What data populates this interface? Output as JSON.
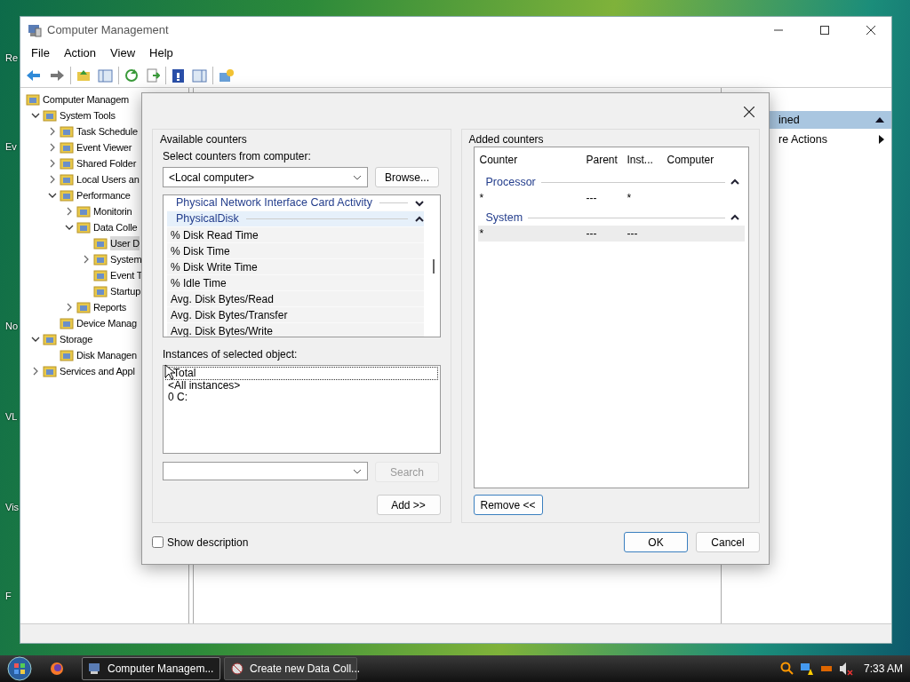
{
  "desktop": {
    "icon_labels": [
      {
        "label": "Re"
      },
      {
        "label": "Ev"
      },
      {
        "label": "No"
      },
      {
        "label": "VL"
      },
      {
        "label": "Vis"
      },
      {
        "label": "F"
      }
    ]
  },
  "window": {
    "title": "Computer Management"
  },
  "menu": [
    "File",
    "Action",
    "View",
    "Help"
  ],
  "tree": [
    {
      "label": "Computer Managem",
      "selected": false,
      "children": [
        {
          "label": "System Tools",
          "expanded": true,
          "selected": false,
          "children": [
            {
              "label": "Task Schedule",
              "expanded": false,
              "selected": false
            },
            {
              "label": "Event Viewer",
              "expanded": false,
              "selected": false
            },
            {
              "label": "Shared Folder",
              "expanded": false,
              "selected": false
            },
            {
              "label": "Local Users an",
              "expanded": false,
              "selected": false
            },
            {
              "label": "Performance",
              "expanded": true,
              "selected": false,
              "children": [
                {
                  "label": "Monitorin",
                  "expanded": false,
                  "selected": false
                },
                {
                  "label": "Data Colle",
                  "expanded": true,
                  "selected": false,
                  "children": [
                    {
                      "label": "User D",
                      "selected": true
                    },
                    {
                      "label": "System",
                      "expanded": false,
                      "selected": false
                    },
                    {
                      "label": "Event T",
                      "selected": false
                    },
                    {
                      "label": "Startup",
                      "selected": false
                    }
                  ]
                },
                {
                  "label": "Reports",
                  "expanded": false,
                  "selected": false
                }
              ]
            },
            {
              "label": "Device Manag",
              "selected": false
            }
          ]
        },
        {
          "label": "Storage",
          "expanded": true,
          "selected": false,
          "children": [
            {
              "label": "Disk Managen",
              "selected": false
            }
          ]
        },
        {
          "label": "Services and Appl",
          "expanded": false,
          "selected": false
        }
      ]
    }
  ],
  "actions": {
    "header": "ined",
    "items": [
      "re Actions"
    ]
  },
  "dialog": {
    "available": {
      "title": "Available counters",
      "computer_label": "Select counters from computer:",
      "computer_value": "<Local computer>",
      "browse_button": "Browse...",
      "objects": [
        {
          "kind": "group",
          "label": "Physical Network Interface Card Activity",
          "expanded": false,
          "selected": false
        },
        {
          "kind": "group",
          "label": "PhysicalDisk",
          "expanded": true,
          "selected": true
        },
        {
          "kind": "counter",
          "label": "% Disk Read Time"
        },
        {
          "kind": "counter",
          "label": "% Disk Time"
        },
        {
          "kind": "counter",
          "label": "% Disk Write Time"
        },
        {
          "kind": "counter",
          "label": "% Idle Time"
        },
        {
          "kind": "counter",
          "label": "Avg. Disk Bytes/Read"
        },
        {
          "kind": "counter",
          "label": "Avg. Disk Bytes/Transfer"
        },
        {
          "kind": "counter",
          "label": "Avg. Disk Bytes/Write"
        }
      ],
      "instances_label": "Instances of selected object:",
      "instances": [
        {
          "label": "Total",
          "selected": true
        },
        {
          "label": "<All instances>",
          "selected": false
        },
        {
          "label": "0 C:",
          "selected": false
        }
      ],
      "search_button": {
        "label": "Search",
        "disabled": true
      },
      "add_button": "Add >>"
    },
    "added": {
      "title": "Added counters",
      "columns": [
        "Counter",
        "Parent",
        "Inst...",
        "Computer"
      ],
      "groups": [
        {
          "name": "Processor",
          "expanded": true,
          "rows": [
            {
              "counter": "*",
              "parent": "---",
              "instance": "*",
              "selected": false
            }
          ]
        },
        {
          "name": "System",
          "expanded": true,
          "rows": [
            {
              "counter": "*",
              "parent": "---",
              "instance": "---",
              "selected": true
            }
          ]
        }
      ],
      "remove_button": "Remove <<"
    },
    "show_description": {
      "label": "Show description",
      "checked": false
    },
    "ok_button": "OK",
    "cancel_button": "Cancel"
  },
  "taskbar": {
    "tasks": [
      {
        "label": "Computer Managem...",
        "selected": true
      },
      {
        "label": "Create new Data Coll...",
        "selected": false
      }
    ],
    "clock": "7:33 AM"
  }
}
